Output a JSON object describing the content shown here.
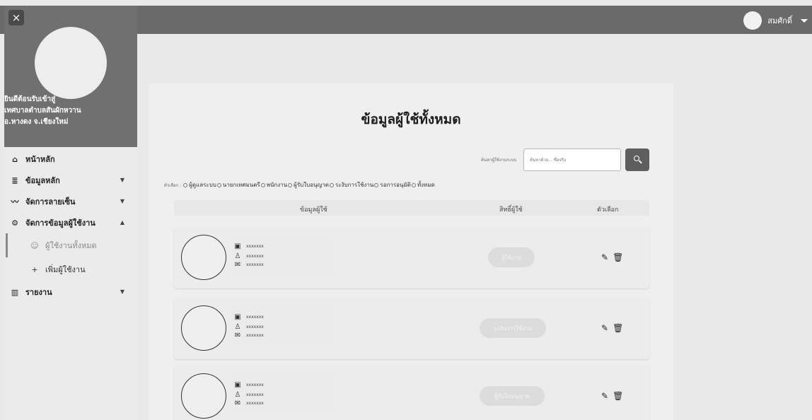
{
  "topbar": {
    "user_name": "สมศักดิ์"
  },
  "sidebar": {
    "close_icon": "×",
    "welcome_lines": [
      "ยินดีต้อนรับเข้าสู่",
      "เทศบาลตำบลสันผักหวาน",
      "อ.หางดง จ.เชียงใหม่"
    ],
    "menu": [
      {
        "label": "หน้าหลัก",
        "icon": "home-icon",
        "glyph": "⌂"
      },
      {
        "label": "ข้อมูลหลัก",
        "icon": "database-icon",
        "glyph": "≣"
      },
      {
        "label": "จัดการลายเซ็น",
        "icon": "signature-icon",
        "glyph": "〰"
      },
      {
        "label": "จัดการข้อมูลผู้ใช้งาน",
        "icon": "users-cog-icon",
        "glyph": "⚙"
      },
      {
        "label": "ผู้ใช้งานทั้งหมด",
        "icon": "users-icon",
        "glyph": "☺"
      },
      {
        "label": "เพิ่มผู้ใช้งาน",
        "icon": "add-user-icon",
        "glyph": "+"
      },
      {
        "label": "รายงาน",
        "icon": "report-icon",
        "glyph": "▥"
      }
    ]
  },
  "main": {
    "title": "ข้อมูลผู้ใช้ทั้งหมด",
    "search": {
      "label": "ค้นหาผู้ใช้งานระบบ",
      "placeholder": "ค้นหาด้วย... ชื่อจริง"
    },
    "filters": {
      "label": "ตัวเลือก :",
      "options": [
        "ผู้ดูแลระบบ",
        "นายกเทศมนตรี",
        "พนักงาน",
        "ผู้รับใบอนุญาต",
        "ระงับการใช้งาน",
        "รอการอนุมัติ",
        "ทั้งหมด"
      ]
    },
    "table_headers": [
      "ข้อมูลผู้ใช้",
      "สิทธิ์ผู้ใช้",
      "ตัวเลือก"
    ],
    "rows": [
      {
        "id": "xxxxxxx",
        "name": "xxxxxxx",
        "email": "xxxxxxx",
        "status": "ผู้ใช้งาน"
      },
      {
        "id": "xxxxxxx",
        "name": "xxxxxxx",
        "email": "xxxxxxx",
        "status": "ระงับการใช้งาน"
      },
      {
        "id": "xxxxxxx",
        "name": "xxxxxxx",
        "email": "xxxxxxx",
        "status": "ผู้รับใบอนุญาต"
      }
    ],
    "action_glyphs": {
      "edit": "✎",
      "delete": "🗑"
    }
  }
}
